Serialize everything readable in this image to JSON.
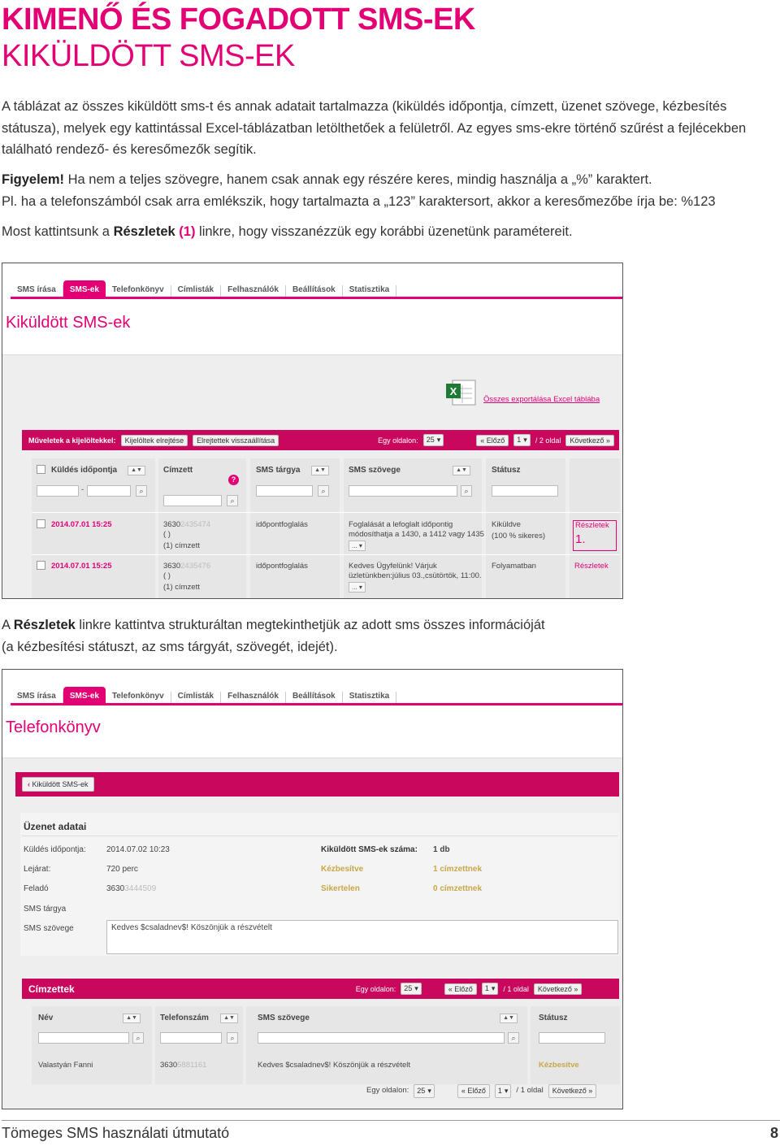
{
  "title": "KIMENŐ ÉS FOGADOTT SMS-EK",
  "subtitle": "KIKÜLDÖTT SMS-EK",
  "intro": "A táblázat az összes kiküldött sms-t és annak adatait tartalmazza (kiküldés időpontja, címzett, üzenet szövege, kézbesítés státusza), melyek egy kattintással Excel-táblázatban letölthetőek a felületről. Az egyes sms-ekre történő szűrést a fejlécekben található rendező- és keresőmezők segítik.",
  "warning": {
    "label": "Figyelem!",
    "text": " Ha nem a teljes szövegre, hanem csak annak egy részére keres, mindig használja a „%” karaktert.",
    "example": "Pl. ha a telefonszámból csak arra emlékszik, hogy tartalmazta a „123” karaktersort, akkor a keresőmezőbe írja be: %123"
  },
  "instruction": {
    "before": "Most kattintsunk a ",
    "link": "Részletek",
    "num": "(1)",
    "after": " linkre, hogy visszanézzük egy korábbi üzenetünk paramétereit."
  },
  "details_text": {
    "before": "A ",
    "link": "Részletek",
    "after": " linkre kattintva strukturáltan megtekinthetjük az adott sms összes információját",
    "line2": "(a kézbesítési státuszt, az sms tárgyát, szövegét, idejét)."
  },
  "nav_tabs": [
    "SMS írása",
    "SMS-ek",
    "Telefonkönyv",
    "Címlisták",
    "Felhasználók",
    "Beállítások",
    "Statisztika"
  ],
  "shot1": {
    "heading": "Kiküldött SMS-ek",
    "export_label": "Összes exportálása Excel táblába",
    "actions_label": "Műveletek a kijelöltekkel:",
    "btn_hide": "Kijelöltek elrejtése",
    "btn_restore": "Elrejtettek visszaállítása",
    "per_page_label": "Egy oldalon:",
    "per_page": "25",
    "prev": "« Előző",
    "page": "1",
    "page_of": "/ 2 oldal",
    "next": "Következő »",
    "columns": [
      "Küldés időpontja",
      "Címzett",
      "SMS tárgya",
      "SMS szövege",
      "Státusz"
    ],
    "date_sep": "-",
    "help": "?",
    "rows": [
      {
        "date": "2014.07.01 15:25",
        "recipient": "3630",
        "recipient_blur": "2435474",
        "recipient_l2": "( )",
        "recipient_l3": "(1) címzett",
        "subject": "időpontfoglalás",
        "text_l1": "Foglalását a lefoglalt időpontig",
        "text_l2": "módosíthatja a 1430, a 1412 vagy 1435",
        "more": "...",
        "status_l1": "Kiküldve",
        "status_l2": "(100 % sikeres)",
        "link": "Részletek",
        "callout": "1."
      },
      {
        "date": "2014.07.01 15:25",
        "recipient": "3630",
        "recipient_blur": "2435476",
        "recipient_l2": "( )",
        "recipient_l3": "(1) címzett",
        "subject": "időpontfoglalás",
        "text_l1": "Kedves Ügyfelünk! Várjuk",
        "text_l2": "üzletünkben:július 03.,csütörtök, 11:00.",
        "more": "...",
        "status_l1": "Folyamatban",
        "link": "Részletek"
      }
    ]
  },
  "shot2": {
    "heading": "Telefonkönyv",
    "back": "Kiküldött SMS-ek",
    "section": "Üzenet adatai",
    "fields": [
      {
        "label": "Küldés időpontja:",
        "value": "2014.07.02 10:23"
      },
      {
        "label": "Lejárat:",
        "value": "720 perc"
      },
      {
        "label": "Feladó",
        "value": "3630",
        "blur": "3444509"
      },
      {
        "label": "SMS tárgya",
        "value": ""
      },
      {
        "label": "SMS szövege",
        "value": "Kedves $csaladnev$! Köszönjük a részvételt"
      }
    ],
    "count_label": "Kiküldött SMS-ek száma:",
    "count_value": "1 db",
    "delivered_label": "Kézbesítve",
    "delivered_value": "1 címzettnek",
    "failed_label": "Sikertelen",
    "failed_value": "0 címzettnek",
    "recipients_title": "Címzettek",
    "per_page_label": "Egy oldalon:",
    "per_page": "25",
    "prev": "« Előző",
    "page": "1",
    "page_of": "/ 1 oldal",
    "next": "Következő »",
    "columns": [
      "Név",
      "Telefonszám",
      "SMS szövege",
      "Státusz"
    ],
    "row": {
      "name": "Valastyán Fanni",
      "phone": "3630",
      "phone_blur": "5881161",
      "text": "Kedves $csaladnev$! Köszönjük a részvételt",
      "status": "Kézbesítve"
    }
  },
  "footer": {
    "left": "Tömeges SMS használati útmutató",
    "page": "8"
  },
  "colors": {
    "magenta": "#e20074",
    "bar": "#c9075d",
    "gold": "#c8a64a"
  }
}
